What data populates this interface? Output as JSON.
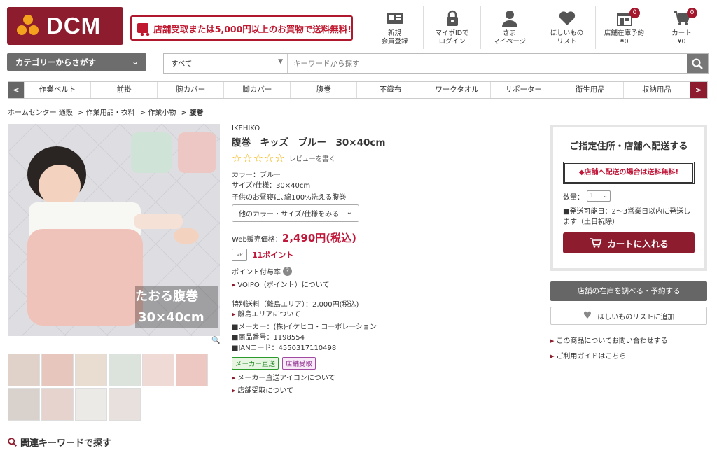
{
  "header": {
    "logo_text": "DCM",
    "banner_text": "店舗受取または5,000円以上のお買物で送料無料!",
    "nav": [
      {
        "line1": "新規",
        "line2": "会員登録",
        "icon": "member-card-icon"
      },
      {
        "line1": "マイポIDで",
        "line2": "ログイン",
        "icon": "lock-icon"
      },
      {
        "line1": "さま",
        "line2": "マイページ",
        "icon": "user-icon"
      },
      {
        "line1": "ほしいもの",
        "line2": "リスト",
        "icon": "heart-icon"
      },
      {
        "line1": "店舗在庫予約",
        "line2": "¥0",
        "badge": "0",
        "icon": "store-icon"
      },
      {
        "line1": "カート",
        "line2": "¥0",
        "badge": "0",
        "icon": "cart-icon"
      }
    ]
  },
  "search": {
    "category_button": "カテゴリーからさがす",
    "scope": "すべて",
    "placeholder": "キーワードから探す"
  },
  "category_bar": {
    "prev": "<",
    "next": ">",
    "items": [
      "作業ベルト",
      "前掛",
      "腕カバー",
      "脚カバー",
      "腹巻",
      "不織布",
      "ワークタオル",
      "サポーター",
      "衛生用品",
      "収納用品"
    ]
  },
  "breadcrumb": [
    "ホームセンター 通販",
    "> 作業用品・衣料",
    "> 作業小物",
    "> 腹巻"
  ],
  "product": {
    "brand": "IKEHIKO",
    "title": "腹巻　キッズ　ブルー　30×40cm",
    "review_link": "レビューを書く",
    "color": "カラー：ブルー",
    "size": "サイズ/仕様：30×40cm",
    "desc": "子供のお昼寝に､綿100%洗える腹巻",
    "variant_button": "他のカラー・サイズ/仕様をみる",
    "price_label": "Web販売価格：",
    "price": "2,490円(税込)",
    "vp_label": "VP",
    "points": "11ポイント",
    "point_rate": "ポイント付与率",
    "voipo_link": "VOIPO（ポイント）について",
    "special_shipping": "特別送料（離島エリア）：2,000円(税込)",
    "island_link": "離島エリアについて",
    "maker": "■メーカー：(株)イケヒコ・コーポレーション",
    "product_no": "■商品番号：1198554",
    "jan": "■JANコード：4550317110498",
    "tag_direct": "メーカー直送",
    "tag_store": "店舗受取",
    "direct_icon_link": "メーカー直送アイコンについて",
    "store_pickup_link": "店舗受取について",
    "image_caption": "たおる腹巻",
    "image_size": "30×40cm",
    "rating": 0
  },
  "buybox": {
    "title": "ご指定住所・店舗へ配送する",
    "free_notice": "◆店舗へ配送の場合は送料無料!",
    "qty_label": "数量：",
    "qty_value": "1",
    "ship_info": "■発送可能日：2～3営業日以内に発送します（土日祝除）",
    "cart_button": "カートに入れる",
    "stock_button": "店舗の在庫を調べる・予約する",
    "wish_button": "ほしいものリストに追加",
    "inquiry_link": "この商品についてお問い合わせする",
    "guide_link": "ご利用ガイドはこちら"
  },
  "related": {
    "title": "関連キーワードで探す"
  },
  "colors": {
    "brand": "#8d1c2e",
    "price": "#c0183a",
    "star": "#f0b000"
  }
}
